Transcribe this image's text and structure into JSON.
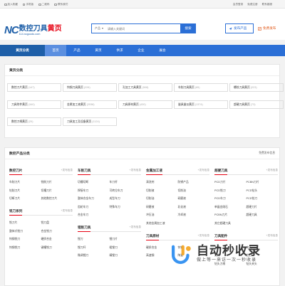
{
  "topbar": {
    "left": [
      "加入收藏",
      "手机版",
      "二维码",
      "联系我们"
    ],
    "right": [
      "会员登录",
      "免费注册",
      "联系客服"
    ]
  },
  "logo": {
    "nc": "NC",
    "cn1": "数控刀具",
    "cn2": "黄页",
    "url": "114.ncgoods.com"
  },
  "search": {
    "type": "产品",
    "placeholder": "请输入关键词",
    "button": "搜索"
  },
  "header_buttons": {
    "publish": "发布产品",
    "free": "免费发布"
  },
  "nav": {
    "category": "黄页分类",
    "items": [
      "首页",
      "产品",
      "黄页",
      "供求",
      "企业",
      "展会"
    ],
    "active": 0
  },
  "section1": {
    "title": "黄页分类",
    "items": [
      {
        "name": "数控刀片黄页",
        "count": "(147)"
      },
      {
        "name": "钨钢刀具黄页",
        "count": "(228)"
      },
      {
        "name": "孔加工刀具黄页",
        "count": "(508)"
      },
      {
        "name": "车削刀具黄页",
        "count": "(85)"
      },
      {
        "name": "螺纹刀具黄页",
        "count": "(223)"
      },
      {
        "name": "刀具附件黄页",
        "count": "(340)"
      },
      {
        "name": "金属加工液黄页",
        "count": "(2538)"
      },
      {
        "name": "刀具原材黄页",
        "count": "(430)"
      },
      {
        "name": "量具量仪黄页",
        "count": "(1374)"
      },
      {
        "name": "超硬刀具黄页",
        "count": "(73)"
      },
      {
        "name": "数控刀柄黄页",
        "count": "(29)"
      },
      {
        "name": "刀具加工及设备黄页",
        "count": "(1124)"
      }
    ]
  },
  "section2": {
    "title": "数控产品分类",
    "more": "免费发布信息"
  },
  "columns": [
    [
      {
        "title": "数控刀片",
        "more": "+发布信息",
        "items": [
          "车削刀片",
          "铣削刀片",
          "钻削刀片",
          "切槽刀片",
          "切断刀片",
          "其他数控刀片"
        ]
      },
      {
        "title": "铣刀系列",
        "more": "+发布信息",
        "items": [
          "铣刀片",
          "铣刀盘",
          "整体式铣刀",
          "合金铣刀",
          "钨钢铣刀",
          "硬质合金",
          "钨钢铣刀",
          "键槽铣刀"
        ]
      }
    ],
    [
      {
        "title": "车削刀具",
        "more": "+发布信息",
        "items": [
          "切槽切断",
          "车刀杆",
          "焊接车刀",
          "可转位车刀",
          "整体合金车刀",
          "成型车刀",
          "齿轮车刀",
          "特殊车刀",
          "合金车刀"
        ]
      },
      {
        "title": "镗削刀具",
        "more": "+发布信息",
        "items": [
          "镗刀",
          "镗刀片",
          "镗刀杆",
          "粗镗刀",
          "微调镗刀",
          "精镗刀"
        ]
      }
    ],
    [
      {
        "title": "金属加工液",
        "more": "+发布信息",
        "items": [
          "清洗剂",
          "防锈产品",
          "切削液",
          "切削油",
          "切削油",
          "研磨液",
          "研磨液",
          "乳化液",
          "冲压油",
          "冷却液",
          "其他金属加工液"
        ]
      },
      {
        "title": "刀具原材",
        "more": "+发布信息",
        "items": [
          "硬质合金",
          "钨钢",
          "高速钢",
          "陶瓷"
        ]
      }
    ],
    [
      {
        "title": "超硬刀具",
        "more": "+发布信息",
        "items": [
          "PCD刀片",
          "PCBN刀片",
          "PCD铣刀",
          "PCD钻头",
          "PCD车刀",
          "PCD铰刀",
          "单晶金刚石",
          "超硬刀片",
          "PCBN刀片",
          "超硬刀具",
          "其它超硬刀具"
        ]
      },
      {
        "title": "刀具配件",
        "more": "+发布信息",
        "items": [
          "刀柄",
          "夹头",
          "刀杆",
          "拉钉",
          "钻头刀柄",
          "钻头夹头"
        ]
      }
    ]
  ],
  "watermark": {
    "title": "自动秒收录",
    "sub": "做上等一来访一次一秒收录"
  },
  "colors": {
    "accent": "#2b6fd6",
    "nav_dark": "#1e5fa8",
    "red": "#e60012",
    "orange": "#e25c1e"
  }
}
